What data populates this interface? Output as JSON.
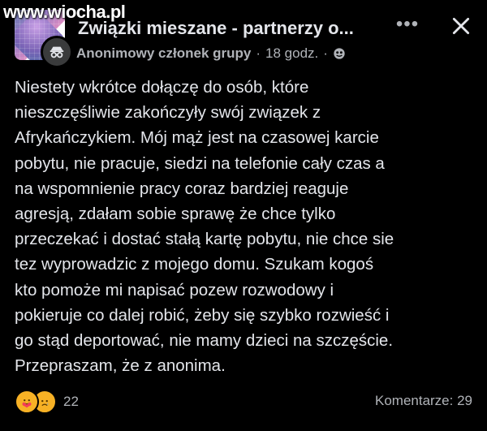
{
  "watermark": "www.wiocha.pl",
  "header": {
    "group_title": "Związki mieszane - partnerzy o...",
    "author": "Anonimowy członek grupy",
    "separator": "·",
    "timestamp": "18 godz.",
    "privacy_icon": "globe-icon",
    "more_label": "•••",
    "close_icon": "close-icon"
  },
  "post": {
    "text": "Niestety wkrótce dołączę do osób, które\nnieszczęśliwie zakończyły swój związek z\nAfrykańczykiem. Mój mąż jest na czasowej karcie\npobytu, nie pracuje, siedzi na telefonie cały czas a\nna wspomnienie pracy coraz bardziej reaguje\nagresją, zdałam sobie sprawę że chce tylko\nprzeczekać i dostać stałą kartę pobytu, nie chce sie\ntez wyprowadzic z mojego domu. Szukam kogoś\nkto pomoże mi napisać pozew rozwodowy i\npokieruje co dalej robić, żeby się szybko rozwieść i\ngo stąd deportować, nie mamy dzieci na szczęście.\nPrzepraszam, że z anonima."
  },
  "footer": {
    "reaction_icons": [
      "care-emoji-icon",
      "sad-emoji-icon"
    ],
    "reaction_count": "22",
    "comments": "Komentarze: 29"
  },
  "colors": {
    "background": "#000000",
    "text_primary": "#e4e6eb",
    "text_secondary": "#b0b3b8",
    "reaction_yellow": "#f7b125"
  }
}
